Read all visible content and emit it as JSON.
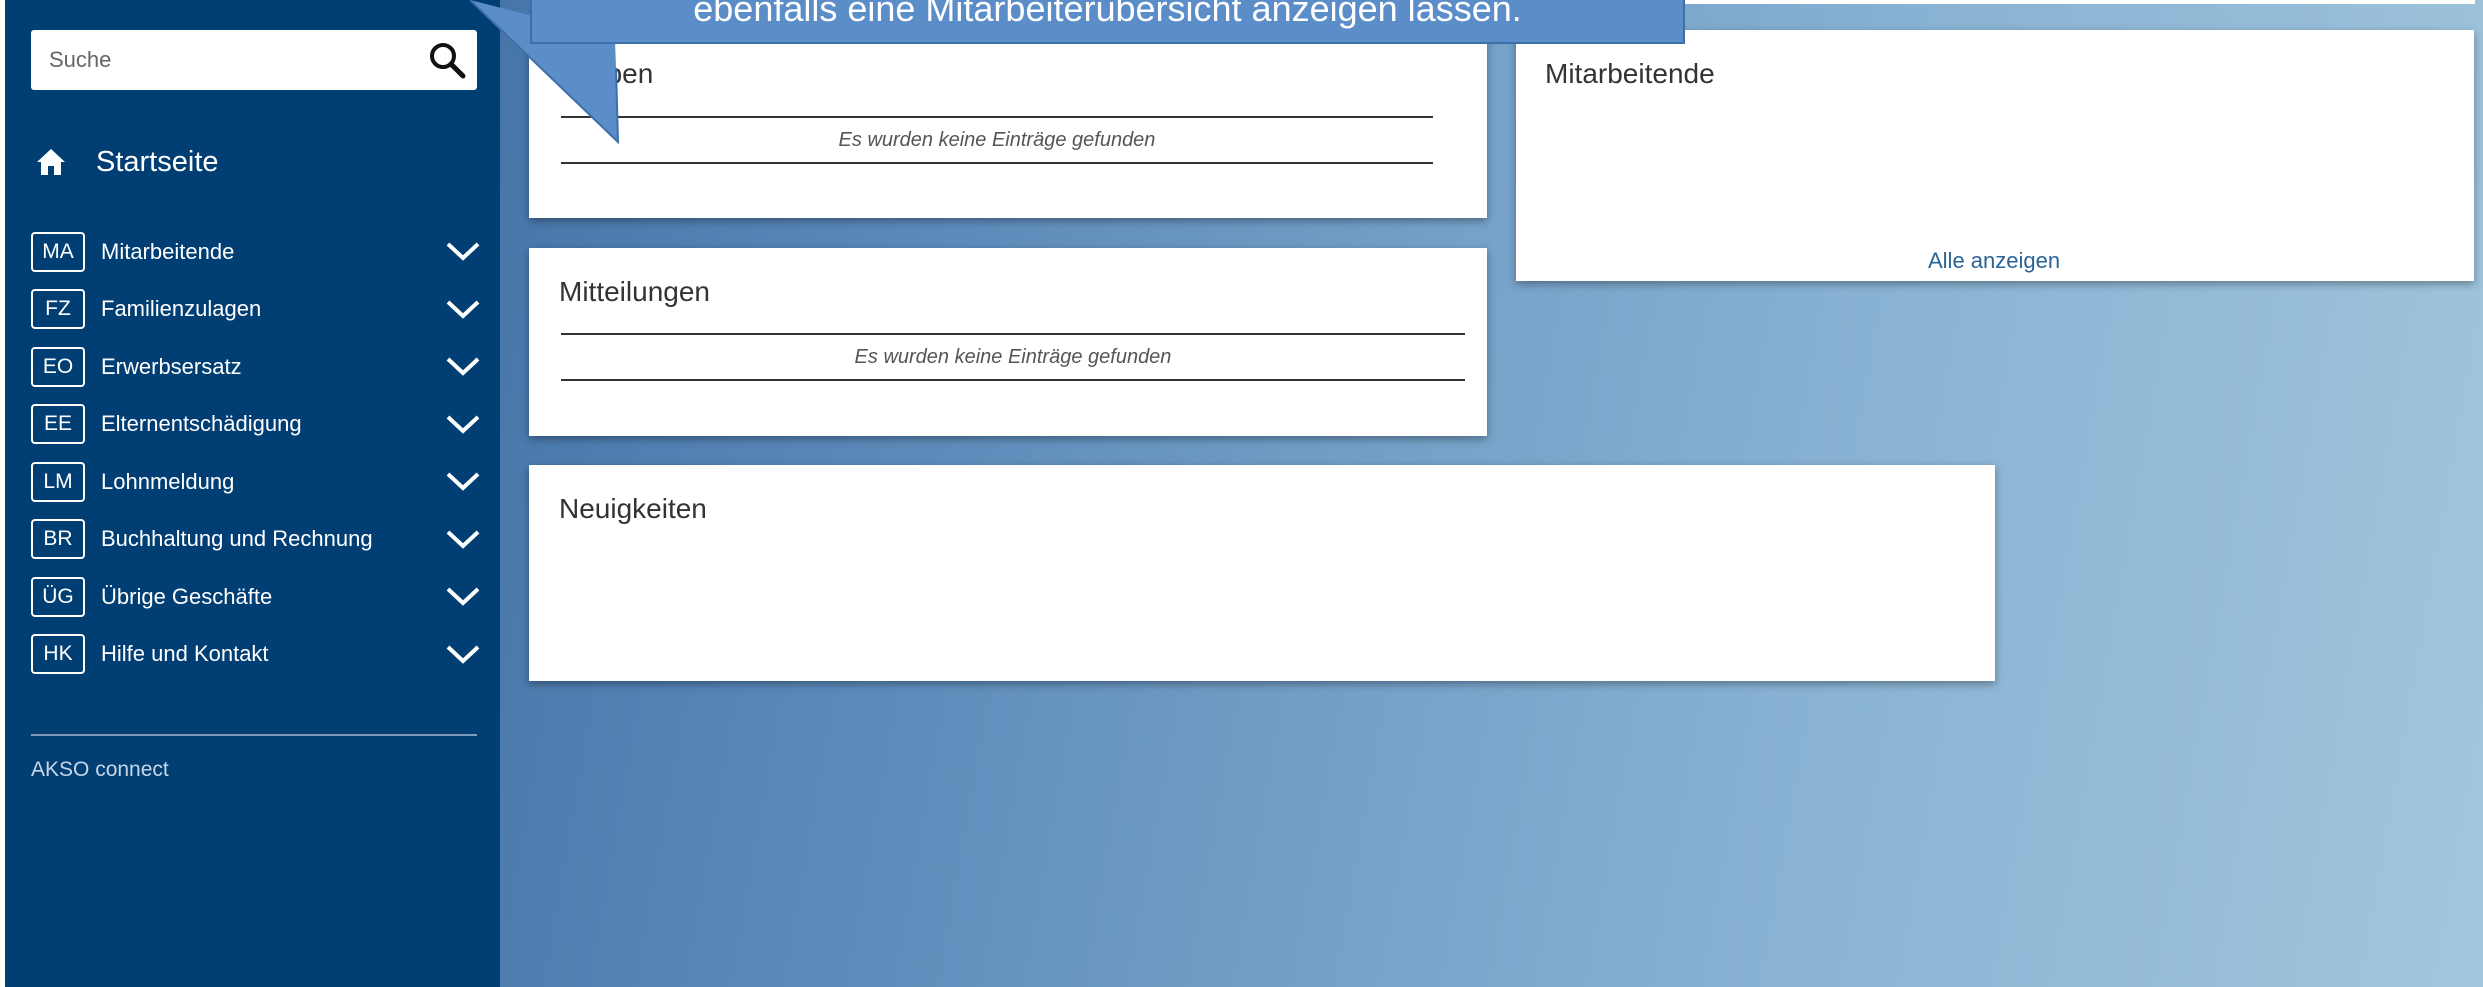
{
  "search": {
    "placeholder": "Suche"
  },
  "nav": {
    "home_label": "Startseite",
    "items": [
      {
        "abbr": "MA",
        "label": "Mitarbeitende"
      },
      {
        "abbr": "FZ",
        "label": "Familienzulagen"
      },
      {
        "abbr": "EO",
        "label": "Erwerbsersatz"
      },
      {
        "abbr": "EE",
        "label": "Elternentschädigung"
      },
      {
        "abbr": "LM",
        "label": "Lohnmeldung"
      },
      {
        "abbr": "BR",
        "label": "Buchhaltung und Rechnung"
      },
      {
        "abbr": "ÜG",
        "label": "Übrige Geschäfte"
      },
      {
        "abbr": "HK",
        "label": "Hilfe und Kontakt"
      }
    ]
  },
  "footer": {
    "brand": "AKSO connect"
  },
  "cards": {
    "aufgaben": {
      "title": "aben",
      "empty": "Es wurden keine Einträge gefunden"
    },
    "mitteilungen": {
      "title": "Mitteilungen",
      "empty": "Es wurden keine Einträge gefunden"
    },
    "neuigkeiten": {
      "title": "Neuigkeiten"
    },
    "mitarbeitende": {
      "title": "Mitarbeitende",
      "link": "Alle anzeigen"
    }
  },
  "callout": {
    "text": "ebenfalls eine Mitarbeiterübersicht anzeigen lassen."
  },
  "colors": {
    "sidebar": "#003e73",
    "callout": "#5b8dc9",
    "link": "#2a6496"
  }
}
